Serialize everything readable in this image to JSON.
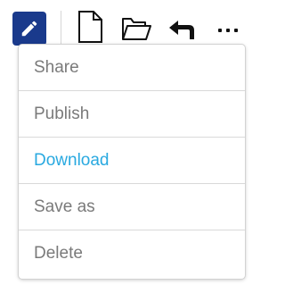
{
  "toolbar": {
    "buttons": [
      {
        "icon": "pencil-icon",
        "selected": true
      },
      {
        "icon": "new-document-icon"
      },
      {
        "icon": "open-folder-icon"
      },
      {
        "icon": "undo-arrow-icon"
      },
      {
        "icon": "more-dots-icon"
      }
    ],
    "accent_color": "#1a3a8c"
  },
  "menu": {
    "items": [
      {
        "label": "Share"
      },
      {
        "label": "Publish"
      },
      {
        "label": "Download",
        "highlighted": true
      },
      {
        "label": "Save as"
      },
      {
        "label": "Delete"
      }
    ],
    "text_color": "#7a7a7a",
    "highlight_color": "#29a9e0"
  }
}
